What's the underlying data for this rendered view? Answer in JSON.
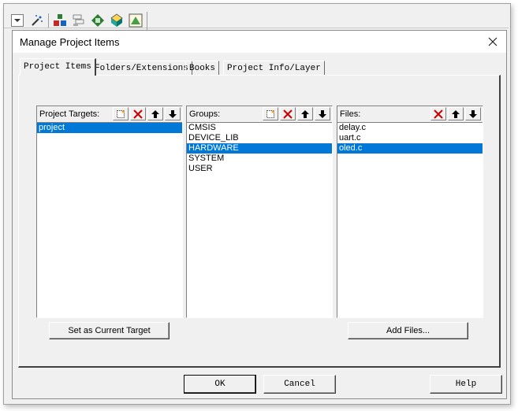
{
  "dialog": {
    "title": "Manage Project Items"
  },
  "tabs": [
    {
      "label": "Project Items"
    },
    {
      "label": "Folders/Extensions"
    },
    {
      "label": "Books"
    },
    {
      "label": "Project Info/Layer"
    }
  ],
  "targets": {
    "label": "Project Targets:",
    "items": [
      "project"
    ],
    "selected": "project"
  },
  "groups": {
    "label": "Groups:",
    "items": [
      "CMSIS",
      "DEVICE_LIB",
      "HARDWARE",
      "SYSTEM",
      "USER"
    ],
    "selected": "HARDWARE"
  },
  "files": {
    "label": "Files:",
    "items": [
      "delay.c",
      "uart.c",
      "oled.c"
    ],
    "selected": "oled.c"
  },
  "buttons": {
    "set_current": "Set as Current Target",
    "add_files": "Add Files...",
    "ok": "OK",
    "cancel": "Cancel",
    "help": "Help"
  },
  "colors": {
    "selection": "#0078d7",
    "dialog_bg": "#f0f0f0"
  },
  "icons": {
    "new": "new-item-icon",
    "delete": "delete-icon",
    "move_up": "arrow-up-icon",
    "move_down": "arrow-down-icon"
  }
}
